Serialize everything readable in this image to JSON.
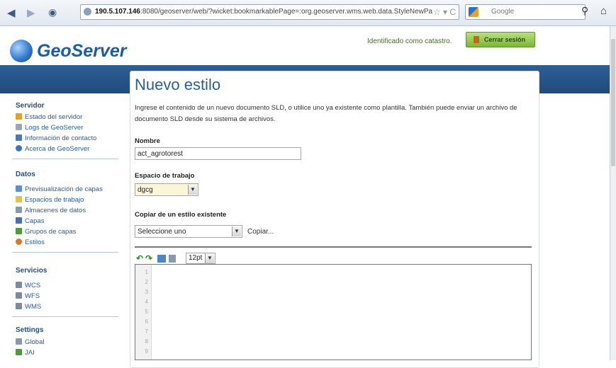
{
  "browser": {
    "url_host": "190.5.107.146",
    "url_rest": ":8080/geoserver/web/?wicket:bookmarkablePage=:org.geoserver.wms.web.data.StyleNewPa",
    "search_engine": "Google",
    "back_icon": "arrow-left",
    "forward_icon": "arrow-right"
  },
  "header": {
    "logo_text": "GeoServer",
    "identified_text": "Identificado como catastro.",
    "logout_label": "Cerrar sesión"
  },
  "sidebar": {
    "sections": [
      {
        "title": "Servidor",
        "items": [
          {
            "label": "Estado del servidor",
            "color": "#e0a42a"
          },
          {
            "label": "Logs de GeoServer",
            "color": "#9aa7b4"
          },
          {
            "label": "Información de contacto",
            "color": "#4a79b5"
          },
          {
            "label": "Acerca de GeoServer",
            "color": "#3b74c4"
          }
        ]
      },
      {
        "title": "Datos",
        "items": [
          {
            "label": "Previsualización de capas",
            "color": "#5b8fd1"
          },
          {
            "label": "Espacios de trabajo",
            "color": "#e5c04a"
          },
          {
            "label": "Almacenes de datos",
            "color": "#8a9aae"
          },
          {
            "label": "Capas",
            "color": "#4a6fb0"
          },
          {
            "label": "Grupos de capas",
            "color": "#4f9a3c"
          },
          {
            "label": "Estilos",
            "color": "#d9782a"
          }
        ]
      },
      {
        "title": "Servicios",
        "items": [
          {
            "label": "WCS",
            "color": "#7a8aa0"
          },
          {
            "label": "WFS",
            "color": "#7a8aa0"
          },
          {
            "label": "WMS",
            "color": "#7a8aa0"
          }
        ]
      },
      {
        "title": "Settings",
        "items": [
          {
            "label": "Global",
            "color": "#8a9aae"
          },
          {
            "label": "JAI",
            "color": "#4f9a3c"
          }
        ]
      }
    ]
  },
  "main": {
    "title": "Nuevo estilo",
    "description": "Ingrese el contenido de un nuevo documento SLD, o utilice uno ya existente como plantilla. También puede enviar un archivo de documento SLD desde su sistema de archivos.",
    "name_label": "Nombre",
    "name_value": "act_agrotorest",
    "workspace_label": "Espacio de trabajo",
    "workspace_value": "dgcg",
    "copy_label": "Copiar de un estilo existente",
    "copy_select": "Seleccione uno",
    "copy_link": "Copiar...",
    "font_size": "12pt",
    "line_numbers": [
      "1",
      "2",
      "3",
      "4",
      "5",
      "6",
      "7",
      "8",
      "9"
    ]
  }
}
